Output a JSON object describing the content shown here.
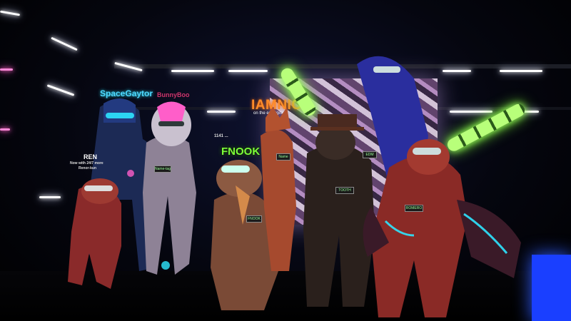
{
  "scene": {
    "type": "vr-social-group-photo",
    "colors": {
      "background": "#05060f",
      "stage_light": "#ffffff",
      "accent_pink": "#ff5ec9",
      "glow_green": "#9dff5c",
      "screen_orange": "#ff8c2a",
      "cyan_glow": "#2ee6ff"
    }
  },
  "stage_screen": {
    "title": "IAMNICK",
    "subtitle": "on the emerging"
  },
  "nametags": [
    {
      "id": "spacegaytor",
      "name": "SpaceGaytor",
      "color": "#4fd9ff"
    },
    {
      "id": "pink-user",
      "name": "BunnyBoo",
      "color": "#ff3f7f"
    },
    {
      "id": "fnook",
      "name": "FNOOK",
      "color": "#7dff3a"
    },
    {
      "id": "ren",
      "name": "REN",
      "status": "Now with 24/7 more",
      "subname": "Renor-kun",
      "color": "#ffffff"
    }
  ],
  "badges": [
    {
      "id": "badge-1",
      "text": "Name-tag"
    },
    {
      "id": "badge-2",
      "text": "FNOOK"
    },
    {
      "id": "badge-3",
      "text": "TOOTH"
    },
    {
      "id": "badge-4",
      "text": "Name"
    },
    {
      "id": "badge-5",
      "text": "ROMERO"
    },
    {
      "id": "badge-6",
      "text": "EDM"
    }
  ],
  "floating_label": {
    "text": "1141 ... "
  }
}
